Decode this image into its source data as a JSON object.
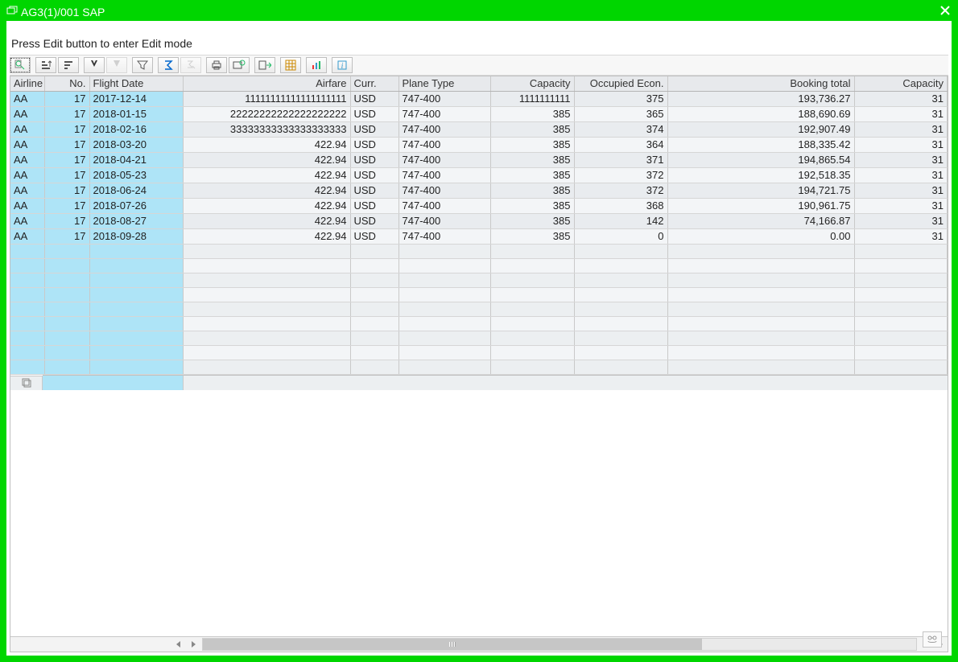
{
  "window": {
    "title": "AG3(1)/001 SAP"
  },
  "info_line": "Press Edit button to enter Edit mode",
  "toolbar": {
    "details": "Details",
    "sort_asc": "Sort ascending",
    "sort_desc": "Sort descending",
    "find": "Find",
    "find_next": "Find next",
    "filter": "Set filter",
    "sum": "Total",
    "subtotal": "Subtotal",
    "print": "Print",
    "views": "Choose layout",
    "export": "Export",
    "layout": "Change layout",
    "chart": "Display graphic",
    "info": "Information"
  },
  "grid": {
    "columns": [
      {
        "id": "airline",
        "label": "Airline",
        "align": "left",
        "key": true
      },
      {
        "id": "no",
        "label": "No.",
        "align": "right",
        "key": true
      },
      {
        "id": "flightdate",
        "label": "Flight Date",
        "align": "left",
        "key": true
      },
      {
        "id": "airfare",
        "label": "Airfare",
        "align": "right",
        "key": false
      },
      {
        "id": "curr",
        "label": "Curr.",
        "align": "left",
        "key": false
      },
      {
        "id": "planetype",
        "label": "Plane Type",
        "align": "left",
        "key": false
      },
      {
        "id": "capacity",
        "label": "Capacity",
        "align": "right",
        "key": false
      },
      {
        "id": "occ",
        "label": "Occupied Econ.",
        "align": "right",
        "key": false
      },
      {
        "id": "booktotal",
        "label": "Booking total",
        "align": "right",
        "key": false
      },
      {
        "id": "capacity2",
        "label": "Capacity",
        "align": "right",
        "key": false
      }
    ],
    "rows": [
      {
        "airline": "AA",
        "no": "17",
        "flightdate": "2017-12-14",
        "airfare": "11111111111111111111",
        "curr": "USD",
        "planetype": "747-400",
        "capacity": "1111111111",
        "occ": "375",
        "booktotal": "193,736.27",
        "capacity2": "31"
      },
      {
        "airline": "AA",
        "no": "17",
        "flightdate": "2018-01-15",
        "airfare": "22222222222222222222",
        "curr": "USD",
        "planetype": "747-400",
        "capacity": "385",
        "occ": "365",
        "booktotal": "188,690.69",
        "capacity2": "31"
      },
      {
        "airline": "AA",
        "no": "17",
        "flightdate": "2018-02-16",
        "airfare": "33333333333333333333",
        "curr": "USD",
        "planetype": "747-400",
        "capacity": "385",
        "occ": "374",
        "booktotal": "192,907.49",
        "capacity2": "31"
      },
      {
        "airline": "AA",
        "no": "17",
        "flightdate": "2018-03-20",
        "airfare": "422.94",
        "curr": "USD",
        "planetype": "747-400",
        "capacity": "385",
        "occ": "364",
        "booktotal": "188,335.42",
        "capacity2": "31"
      },
      {
        "airline": "AA",
        "no": "17",
        "flightdate": "2018-04-21",
        "airfare": "422.94",
        "curr": "USD",
        "planetype": "747-400",
        "capacity": "385",
        "occ": "371",
        "booktotal": "194,865.54",
        "capacity2": "31"
      },
      {
        "airline": "AA",
        "no": "17",
        "flightdate": "2018-05-23",
        "airfare": "422.94",
        "curr": "USD",
        "planetype": "747-400",
        "capacity": "385",
        "occ": "372",
        "booktotal": "192,518.35",
        "capacity2": "31"
      },
      {
        "airline": "AA",
        "no": "17",
        "flightdate": "2018-06-24",
        "airfare": "422.94",
        "curr": "USD",
        "planetype": "747-400",
        "capacity": "385",
        "occ": "372",
        "booktotal": "194,721.75",
        "capacity2": "31"
      },
      {
        "airline": "AA",
        "no": "17",
        "flightdate": "2018-07-26",
        "airfare": "422.94",
        "curr": "USD",
        "planetype": "747-400",
        "capacity": "385",
        "occ": "368",
        "booktotal": "190,961.75",
        "capacity2": "31"
      },
      {
        "airline": "AA",
        "no": "17",
        "flightdate": "2018-08-27",
        "airfare": "422.94",
        "curr": "USD",
        "planetype": "747-400",
        "capacity": "385",
        "occ": "142",
        "booktotal": "74,166.87",
        "capacity2": "31"
      },
      {
        "airline": "AA",
        "no": "17",
        "flightdate": "2018-09-28",
        "airfare": "422.94",
        "curr": "USD",
        "planetype": "747-400",
        "capacity": "385",
        "occ": "0",
        "booktotal": "0.00",
        "capacity2": "31"
      }
    ],
    "empty_rows": 9
  }
}
